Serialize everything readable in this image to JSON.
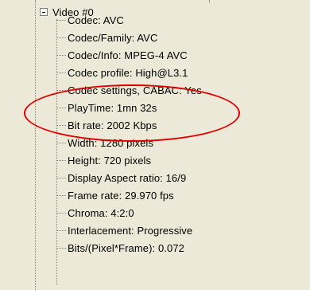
{
  "tree": {
    "root_label": "Video #0",
    "items": [
      "Codec: AVC",
      "Codec/Family: AVC",
      "Codec/Info: MPEG-4 AVC",
      "Codec profile: High@L3.1",
      "Codec settings, CABAC: Yes",
      "PlayTime: 1mn 32s",
      "Bit rate: 2002 Kbps",
      "Width: 1280 pixels",
      "Height: 720 pixels",
      "Display Aspect ratio: 16/9",
      "Frame rate: 29.970 fps",
      "Chroma: 4:2:0",
      "Interlacement: Progressive",
      "Bits/(Pixel*Frame): 0.072"
    ]
  },
  "annotation": {
    "color": "#e00000"
  }
}
